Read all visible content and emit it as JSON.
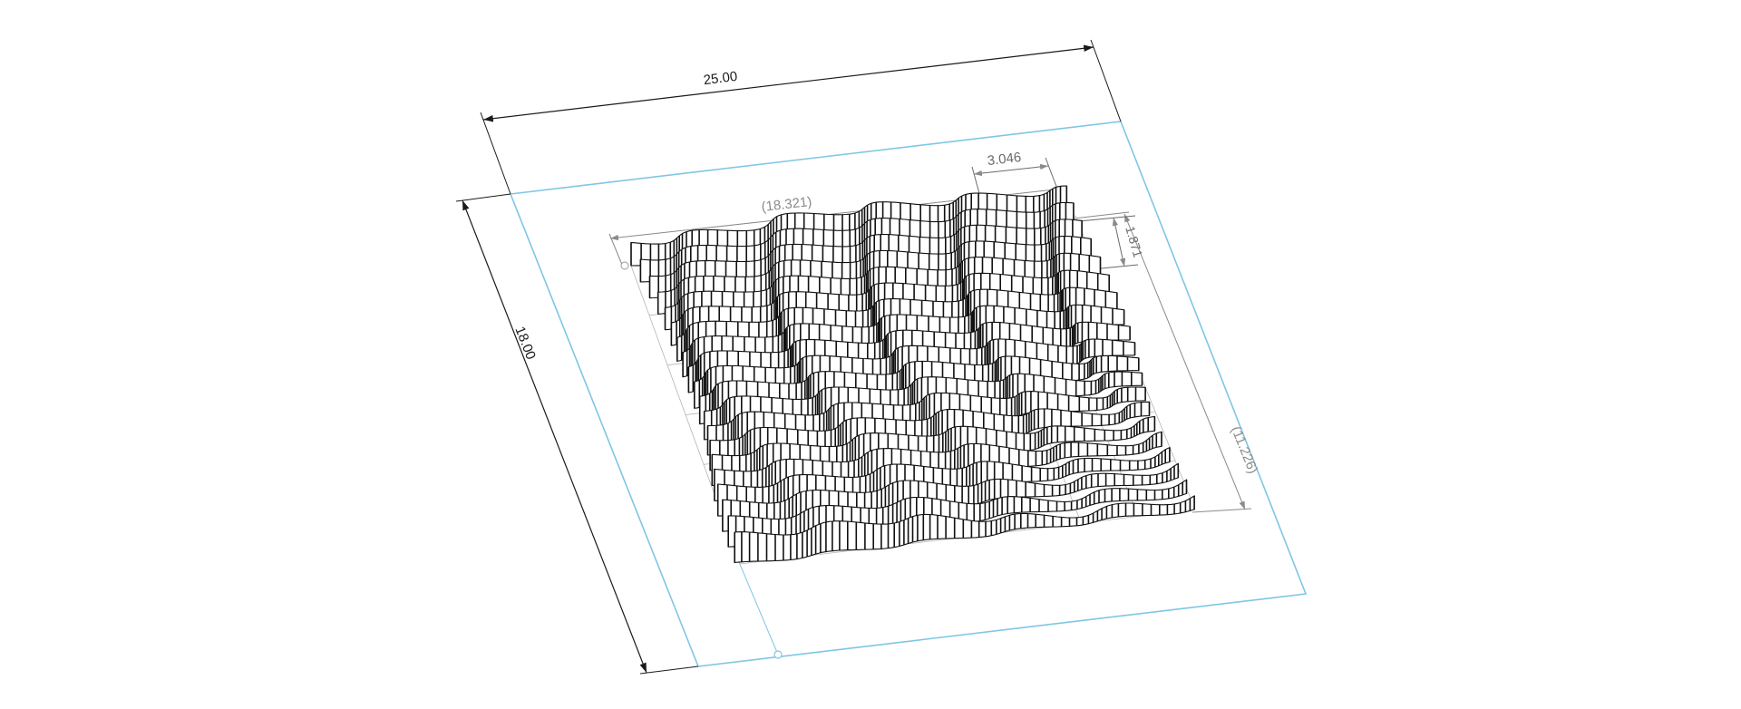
{
  "colors": {
    "background": "#ffffff",
    "sheet_outline": "#7fc6e4",
    "overall_dimension": "#1a1a1a",
    "reference_dimension": "#8a8a8a",
    "wave_stroke": "#111111",
    "wave_fill": "#ffffff"
  },
  "dimensions": {
    "sheet_width": "25.00",
    "sheet_height": "18.00",
    "pattern_width": "(18.321)",
    "pattern_height": "(11.226)",
    "wave_pitch": "3.046",
    "wave_amplitude": "1.871"
  },
  "pattern": {
    "icon": "wave-ribbon-icon",
    "rows": 20
  }
}
